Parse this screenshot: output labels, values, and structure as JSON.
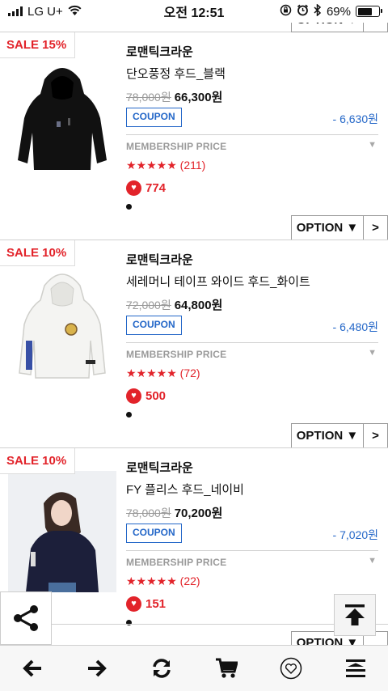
{
  "status": {
    "carrier": "LG U+",
    "time": "오전 12:51",
    "battery": "69%",
    "battery_level": 0.69
  },
  "list": {
    "option_label": "OPTION ▼",
    "next_label": ">",
    "membership_label": "MEMBERSHIP PRICE",
    "coupon_label": "COUPON",
    "items": [
      {
        "sale": "SALE 15%",
        "brand": "로맨틱크라운",
        "name": "단오풍정 후드_블랙",
        "original_price": "78,000원",
        "sale_price": "66,300원",
        "coupon_amount": "- 6,630원",
        "rating_stars": "★★★★★",
        "rating_count": "(211)",
        "likes": "774",
        "image": "black-hoodie"
      },
      {
        "sale": "SALE 10%",
        "brand": "로맨틱크라운",
        "name": "세레머니 테이프 와이드 후드_화이트",
        "original_price": "72,000원",
        "sale_price": "64,800원",
        "coupon_amount": "- 6,480원",
        "rating_stars": "★★★★★",
        "rating_count": "(72)",
        "likes": "500",
        "image": "white-hoodie"
      },
      {
        "sale": "SALE 10%",
        "brand": "로맨틱크라운",
        "name": "FY 플리스 후드_네이비",
        "original_price": "78,000원",
        "sale_price": "70,200원",
        "coupon_amount": "- 7,020원",
        "rating_stars": "★★★★★",
        "rating_count": "(22)",
        "likes": "151",
        "image": "navy-fleece-hoodie-model"
      }
    ]
  },
  "peek": {
    "option_label": "OPTION ▼"
  },
  "toolbar": {
    "buttons": [
      "back-arrow-icon",
      "forward-arrow-icon",
      "refresh-icon",
      "cart-icon",
      "heart-outline-icon",
      "menu-collapse-icon"
    ]
  },
  "colors": {
    "sale_red": "#e2232a",
    "coupon_blue": "#2467c8",
    "muted_gray": "#9a9a9a"
  }
}
